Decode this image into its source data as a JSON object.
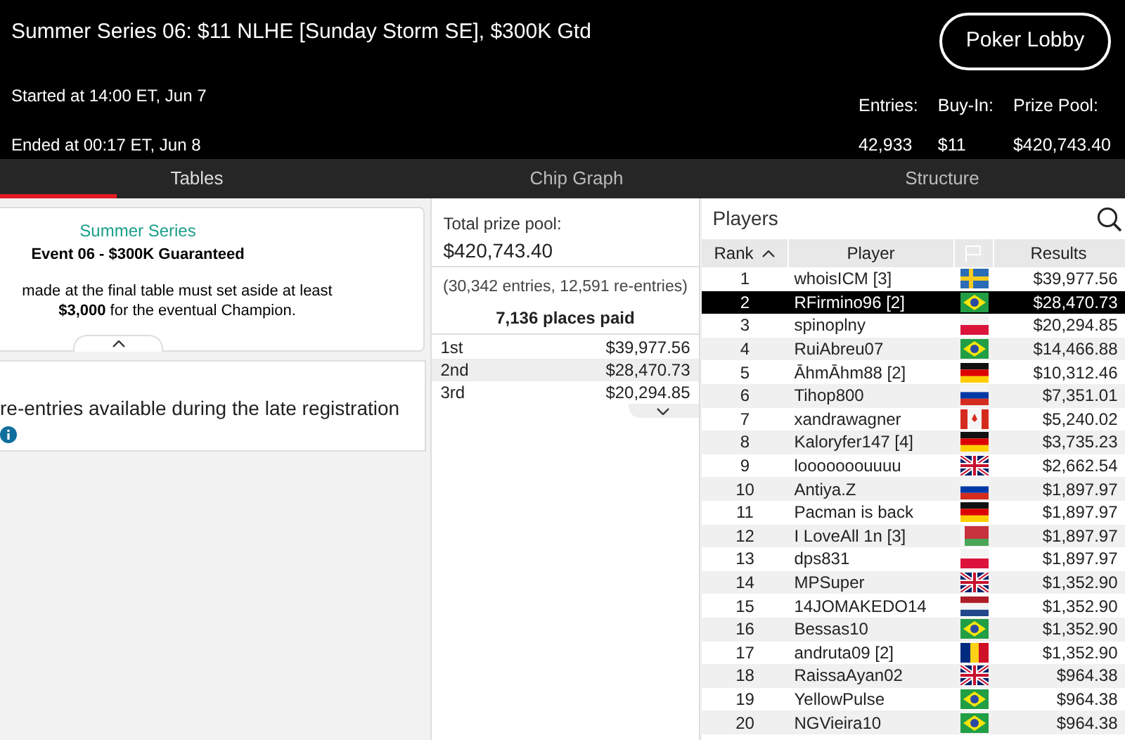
{
  "header": {
    "title": "Summer Series 06: $11 NLHE [Sunday Storm SE], $300K Gtd",
    "lobby_button": "Poker Lobby",
    "started": "Started at 14:00 ET, Jun 7",
    "ended": "Ended at 00:17 ET, Jun 8",
    "stats": [
      {
        "label": "Entries:",
        "value": "42,933"
      },
      {
        "label": "Buy-In:",
        "value": "$11"
      },
      {
        "label": "Prize Pool:",
        "value": "$420,743.40"
      }
    ]
  },
  "tabs": [
    {
      "label": "Tables",
      "selected": true
    },
    {
      "label": "Chip Graph",
      "selected": false
    },
    {
      "label": "Structure",
      "selected": false
    }
  ],
  "info_card": {
    "series": "Summer Series",
    "event": "Event 06 - $300K Guaranteed",
    "note": "made at the final table must set aside at least **$3,000** for the eventual Champion.",
    "expanded": true
  },
  "reentry_card": {
    "text": "re-entries available during the late registration"
  },
  "prize_pool": {
    "label": "Total prize pool:",
    "amount": "$420,743.40",
    "entries": "(30,342 entries, 12,591 re-entries)",
    "places": "7,136 places paid",
    "payouts": [
      {
        "place": "1st",
        "amount": "$39,977.56"
      },
      {
        "place": "2nd",
        "amount": "$28,470.73"
      },
      {
        "place": "3rd",
        "amount": "$20,294.85"
      }
    ]
  },
  "players": {
    "title": "Players",
    "columns": [
      "Rank",
      "Player",
      "Results"
    ],
    "rows": [
      {
        "rank": "1",
        "player": "whoisICM [3]",
        "kind": "se",
        "result": "$39,977.56",
        "selected": false
      },
      {
        "rank": "2",
        "player": "RFirmino96 [2]",
        "kind": "br",
        "result": "$28,470.73",
        "selected": true
      },
      {
        "rank": "3",
        "player": "spinoplny",
        "kind": "pl",
        "result": "$20,294.85",
        "selected": false
      },
      {
        "rank": "4",
        "player": "RuiAbreu07",
        "kind": "br",
        "result": "$14,466.88",
        "selected": false
      },
      {
        "rank": "5",
        "player": "ĀhmĀhm88 [2]",
        "kind": "de",
        "result": "$10,312.46",
        "selected": false
      },
      {
        "rank": "6",
        "player": "Tihop800",
        "kind": "ru",
        "result": "$7,351.01",
        "selected": false
      },
      {
        "rank": "7",
        "player": "xandrawagner",
        "kind": "ca",
        "result": "$5,240.02",
        "selected": false
      },
      {
        "rank": "8",
        "player": "Kaloryfer147 [4]",
        "kind": "de",
        "result": "$3,735.23",
        "selected": false
      },
      {
        "rank": "9",
        "player": "looooooouuuu",
        "kind": "gb",
        "result": "$2,662.54",
        "selected": false
      },
      {
        "rank": "10",
        "player": "Antiya.Z",
        "kind": "ru",
        "result": "$1,897.97",
        "selected": false
      },
      {
        "rank": "11",
        "player": "Pacman is back",
        "kind": "de",
        "result": "$1,897.97",
        "selected": false
      },
      {
        "rank": "12",
        "player": "I LoveAll 1n [3]",
        "kind": "by",
        "result": "$1,897.97",
        "selected": false
      },
      {
        "rank": "13",
        "player": "dps831",
        "kind": "pl",
        "result": "$1,897.97",
        "selected": false
      },
      {
        "rank": "14",
        "player": "MPSuper",
        "kind": "gb",
        "result": "$1,352.90",
        "selected": false
      },
      {
        "rank": "15",
        "player": "14JOMAKEDO14",
        "kind": "nl",
        "result": "$1,352.90",
        "selected": false
      },
      {
        "rank": "16",
        "player": "Bessas10",
        "kind": "br",
        "result": "$1,352.90",
        "selected": false
      },
      {
        "rank": "17",
        "player": "andruta09 [2]",
        "kind": "ro",
        "result": "$1,352.90",
        "selected": false
      },
      {
        "rank": "18",
        "player": "RaissaAyan02",
        "kind": "gb",
        "result": "$964.38",
        "selected": false
      },
      {
        "rank": "19",
        "player": "YellowPulse",
        "kind": "br",
        "result": "$964.38",
        "selected": false
      },
      {
        "rank": "20",
        "player": "NGVieira10",
        "kind": "br",
        "result": "$964.38",
        "selected": false
      }
    ]
  }
}
